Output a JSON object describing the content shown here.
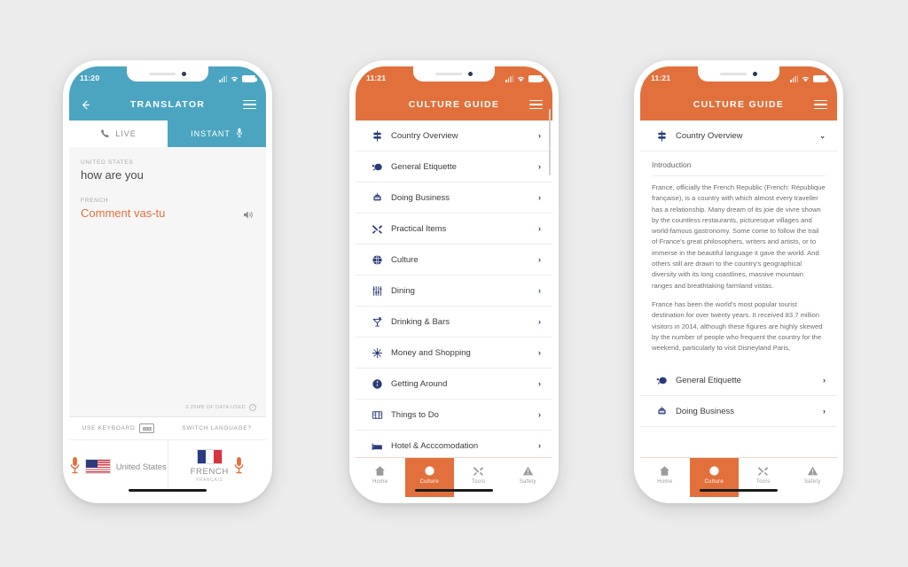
{
  "theme": {
    "teal": "#4ca5c0",
    "orange": "#e2703c",
    "navy": "#2a3b7a",
    "page_bg": "#ececec"
  },
  "phone1": {
    "status": {
      "time": "11:20",
      "signal_icon": "cellular-signal-icon",
      "wifi_icon": "wifi-icon",
      "battery_icon": "battery-icon"
    },
    "appbar": {
      "back_icon": "back-arrow-icon",
      "title": "TRANSLATOR",
      "menu_icon": "hamburger-menu-icon"
    },
    "tabs": [
      {
        "label": "LIVE",
        "icon": "phone-icon",
        "active": true
      },
      {
        "label": "INSTANT",
        "icon": "microphone-icon",
        "active": false
      }
    ],
    "conversation": {
      "source_label": "UNITED STATES",
      "source_text": "how are you",
      "target_label": "FRENCH",
      "target_text": "Comment vas-tu",
      "speaker_icon": "speaker-volume-icon",
      "data_used": "0.25MB OF DATA USED",
      "info_icon": "info-icon"
    },
    "actions": [
      {
        "label": "USE KEYBOARD",
        "icon": "keyboard-icon"
      },
      {
        "label": "SWITCH LANGUAGE?",
        "icon": ""
      }
    ],
    "languages": {
      "left": {
        "name": "United States",
        "sub": "",
        "flag": "us-flag-icon",
        "mic_icon": "microphone-icon"
      },
      "right": {
        "name": "FRENCH",
        "sub": "FRANÇAIS",
        "flag": "fr-flag-icon",
        "mic_icon": "microphone-icon"
      }
    }
  },
  "phone2": {
    "status": {
      "time": "11:21"
    },
    "appbar": {
      "title": "CULTURE GUIDE",
      "menu_icon": "hamburger-menu-icon"
    },
    "list": [
      {
        "label": "Country Overview",
        "icon": "signpost-icon"
      },
      {
        "label": "General Etiquette",
        "icon": "speech-bubble-icon"
      },
      {
        "label": "Doing Business",
        "icon": "open-sign-icon"
      },
      {
        "label": "Practical Items",
        "icon": "tools-icon"
      },
      {
        "label": "Culture",
        "icon": "globe-icon"
      },
      {
        "label": "Dining",
        "icon": "cutlery-icon"
      },
      {
        "label": "Drinking & Bars",
        "icon": "cocktail-icon"
      },
      {
        "label": "Money and Shopping",
        "icon": "sparkle-icon"
      },
      {
        "label": "Getting Around",
        "icon": "info-circle-icon"
      },
      {
        "label": "Things to Do",
        "icon": "map-board-icon"
      },
      {
        "label": "Hotel & Acccomodation",
        "icon": "bed-icon"
      }
    ],
    "chevron": "›",
    "bottom_nav": [
      {
        "label": "Home",
        "icon": "home-icon",
        "active": false
      },
      {
        "label": "Culture",
        "icon": "globe-icon",
        "active": true
      },
      {
        "label": "Tools",
        "icon": "tools-icon",
        "active": false
      },
      {
        "label": "Safety",
        "icon": "warning-triangle-icon",
        "active": false
      }
    ]
  },
  "phone3": {
    "status": {
      "time": "11:21"
    },
    "appbar": {
      "title": "CULTURE GUIDE",
      "menu_icon": "hamburger-menu-icon"
    },
    "expanded": {
      "label": "Country Overview",
      "icon": "signpost-icon",
      "chevron": "⌄"
    },
    "article": {
      "heading": "Introduction",
      "paragraph1": "France, officially the French Republic (French: République française), is a country with which almost every traveller has a relationship. Many dream of its joie de vivre shown by the countless restaurants, picturesque villages and world-famous gastronomy. Some come to follow the trail of France's great philosophers, writers and artists, or to immerse in the beautiful language it gave the world. And others still are drawn to the country's geographical diversity with its long coastlines, massive mountain ranges and breathtaking farmland vistas.",
      "paragraph2": "France has been the world's most popular tourist destination for over twenty years. It received 83.7 million visitors in 2014, although these figures are highly skewed by the number of people who frequent the country for the weekend, particularly to visit Disneyland Paris,"
    },
    "list": [
      {
        "label": "General Etiquette",
        "icon": "speech-bubble-icon"
      },
      {
        "label": "Doing Business",
        "icon": "open-sign-icon"
      }
    ],
    "chevron": "›",
    "bottom_nav": [
      {
        "label": "Home",
        "icon": "home-icon",
        "active": false
      },
      {
        "label": "Culture",
        "icon": "globe-icon",
        "active": true
      },
      {
        "label": "Tools",
        "icon": "tools-icon",
        "active": false
      },
      {
        "label": "Safety",
        "icon": "warning-triangle-icon",
        "active": false
      }
    ]
  }
}
